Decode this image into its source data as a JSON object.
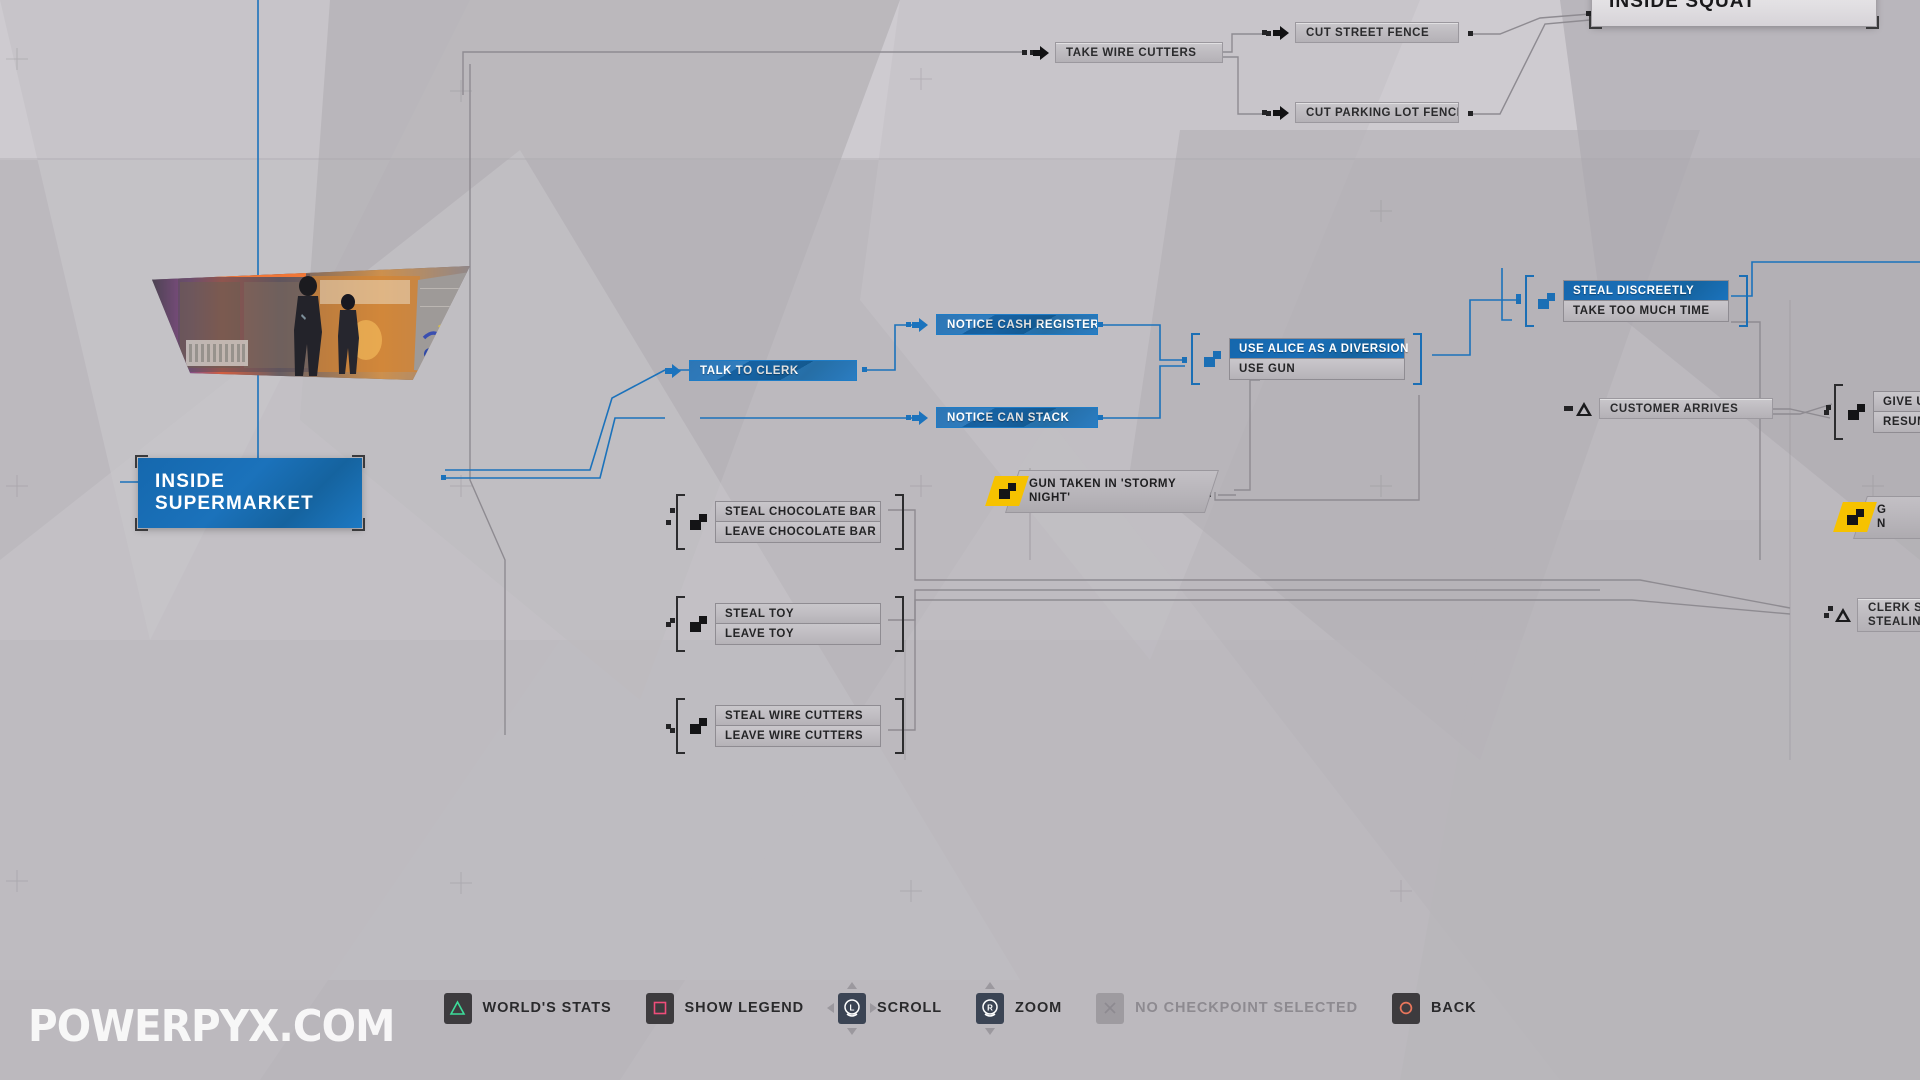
{
  "scene_headers": [
    {
      "id": "inside-supermarket",
      "label": "INSIDE SUPERMARKET",
      "style": "blue"
    },
    {
      "id": "inside-squat",
      "label": "INSIDE SQUAT",
      "style": "light"
    }
  ],
  "nodes": [
    {
      "id": "take-wire-cutters",
      "label": "TAKE WIRE CUTTERS",
      "style": "gray",
      "icon": "arrow-icon"
    },
    {
      "id": "cut-street-fence",
      "label": "CUT STREET FENCE",
      "style": "gray",
      "icon": "arrow-icon"
    },
    {
      "id": "cut-parking-lot-fence",
      "label": "CUT PARKING LOT FENCE",
      "style": "gray",
      "icon": "arrow-icon"
    },
    {
      "id": "talk-to-clerk",
      "label": "TALK TO CLERK",
      "style": "blue",
      "icon": "arrow-icon"
    },
    {
      "id": "notice-cash-register",
      "label": "NOTICE CASH REGISTER",
      "style": "blue",
      "icon": "arrow-icon"
    },
    {
      "id": "notice-can-stack",
      "label": "NOTICE CAN STACK",
      "style": "blue",
      "icon": "arrow-icon"
    },
    {
      "id": "customer-arrives",
      "label": "CUSTOMER ARRIVES",
      "style": "gray",
      "icon": "triangle-icon"
    },
    {
      "id": "clerk-spots-stealing",
      "label": "CLERK SP\nSTEALING",
      "style": "gray",
      "icon": "triangle-icon"
    }
  ],
  "choice_nodes": [
    {
      "id": "alice-or-gun",
      "bracket_style": "blue",
      "options": [
        {
          "label": "USE ALICE AS A DIVERSION",
          "selected": true
        },
        {
          "label": "USE GUN",
          "selected": false
        }
      ]
    },
    {
      "id": "steal-discreetly",
      "bracket_style": "blue",
      "options": [
        {
          "label": "STEAL DISCREETLY",
          "selected": true
        },
        {
          "label": "TAKE TOO MUCH TIME",
          "selected": false
        }
      ]
    },
    {
      "id": "chocolate-bar",
      "bracket_style": "dark",
      "options": [
        {
          "label": "STEAL CHOCOLATE BAR",
          "selected": false
        },
        {
          "label": "LEAVE CHOCOLATE BAR",
          "selected": false
        }
      ]
    },
    {
      "id": "toy",
      "bracket_style": "dark",
      "options": [
        {
          "label": "STEAL TOY",
          "selected": false
        },
        {
          "label": "LEAVE TOY",
          "selected": false
        }
      ]
    },
    {
      "id": "wire-cutters",
      "bracket_style": "dark",
      "options": [
        {
          "label": "STEAL WIRE CUTTERS",
          "selected": false
        },
        {
          "label": "LEAVE WIRE CUTTERS",
          "selected": false
        }
      ]
    },
    {
      "id": "give-up-resume",
      "bracket_style": "dark",
      "options": [
        {
          "label": "GIVE UP",
          "selected": false
        },
        {
          "label": "RESUME",
          "selected": false
        }
      ]
    }
  ],
  "consequence_nodes": [
    {
      "id": "gun-taken-stormy-night",
      "label": "GUN TAKEN IN 'STORMY\nNIGHT'",
      "badge_color": "#f6c200",
      "badge_icon": "lock-icon"
    },
    {
      "id": "gun-clipped-right",
      "label": "G\nN",
      "badge_color": "#f6c200",
      "badge_icon": "lock-icon"
    }
  ],
  "hud": {
    "items": [
      {
        "id": "worlds-stats",
        "label": "WORLD'S STATS",
        "icon": "ps-triangle-icon",
        "icon_color": "#3ddc9a",
        "key_style": "dark",
        "enabled": true
      },
      {
        "id": "show-legend",
        "label": "SHOW LEGEND",
        "icon": "ps-square-icon",
        "icon_color": "#ef4d7a",
        "key_style": "dark",
        "enabled": true
      },
      {
        "id": "scroll",
        "label": "SCROLL",
        "icon": "left-stick-icon",
        "icon_color": "#ffffff",
        "key_style": "navy",
        "enabled": true
      },
      {
        "id": "zoom",
        "label": "ZOOM",
        "icon": "right-stick-icon",
        "icon_color": "#ffffff",
        "key_style": "navy",
        "enabled": true
      },
      {
        "id": "checkpoint",
        "label": "NO CHECKPOINT SELECTED",
        "icon": "ps-cross-icon",
        "icon_color": "#8d8a90",
        "key_style": "dim",
        "enabled": false
      },
      {
        "id": "back",
        "label": "BACK",
        "icon": "ps-circle-icon",
        "icon_color": "#e8765c",
        "key_style": "dark",
        "enabled": true
      }
    ]
  },
  "watermark": {
    "text": "POWERPYX.COM"
  },
  "colors": {
    "accent_blue": "#1b72bb",
    "node_gray": "#bdbabf",
    "background": "#b9b6bb",
    "badge_yellow": "#f6c200"
  }
}
